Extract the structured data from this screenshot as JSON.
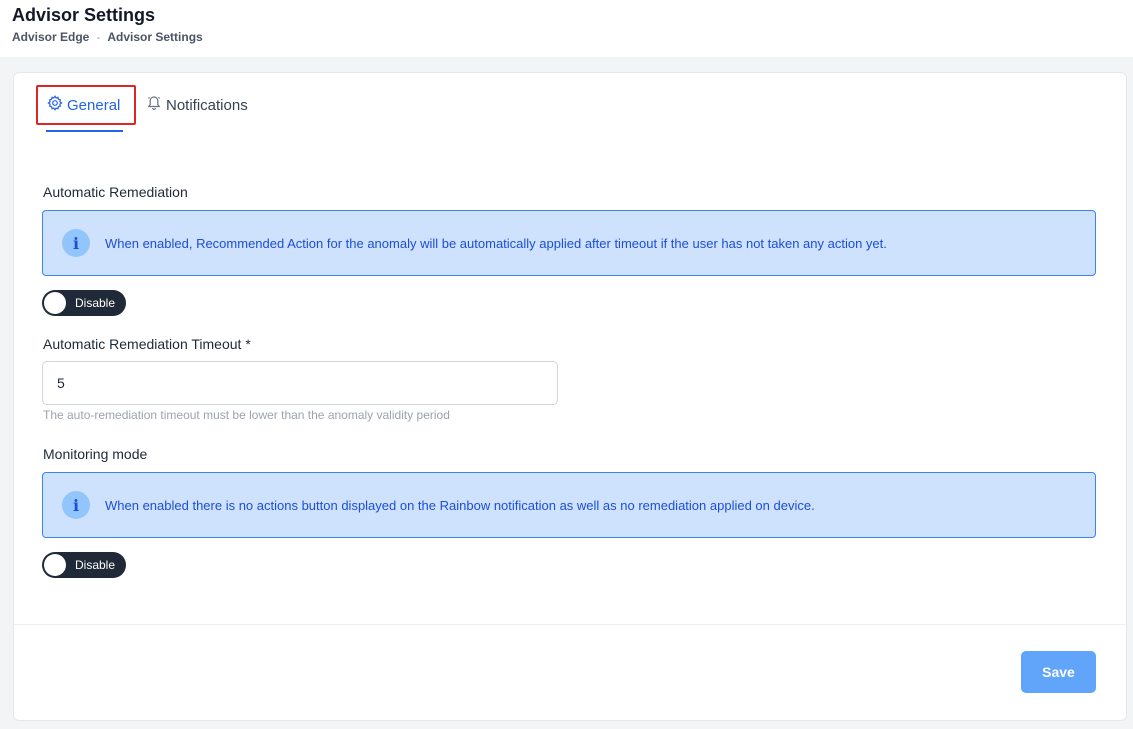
{
  "header": {
    "title": "Advisor Settings",
    "breadcrumb": [
      "Advisor Edge",
      "Advisor Settings"
    ],
    "breadcrumb_separator": "-"
  },
  "tabs": [
    {
      "label": "General",
      "icon": "gear-icon",
      "active": true
    },
    {
      "label": "Notifications",
      "icon": "bell-icon",
      "active": false
    }
  ],
  "auto_remediation": {
    "label": "Automatic Remediation",
    "info": "When enabled, Recommended Action for the anomaly will be automatically applied after timeout if the user has not taken any action yet.",
    "toggle_label": "Disable"
  },
  "timeout": {
    "label": "Automatic Remediation Timeout *",
    "value": "5",
    "help": "The auto-remediation timeout must be lower than the anomaly validity period"
  },
  "monitoring": {
    "label": "Monitoring mode",
    "info": "When enabled there is no actions button displayed on the Rainbow notification as well as no remediation applied on device.",
    "toggle_label": "Disable"
  },
  "footer": {
    "save_label": "Save"
  },
  "colors": {
    "accent": "#2563eb",
    "info_bg": "#cfe2fd",
    "toggle_bg": "#1f2937",
    "save_bg": "#60a5fa",
    "highlight": "#dc2626"
  }
}
